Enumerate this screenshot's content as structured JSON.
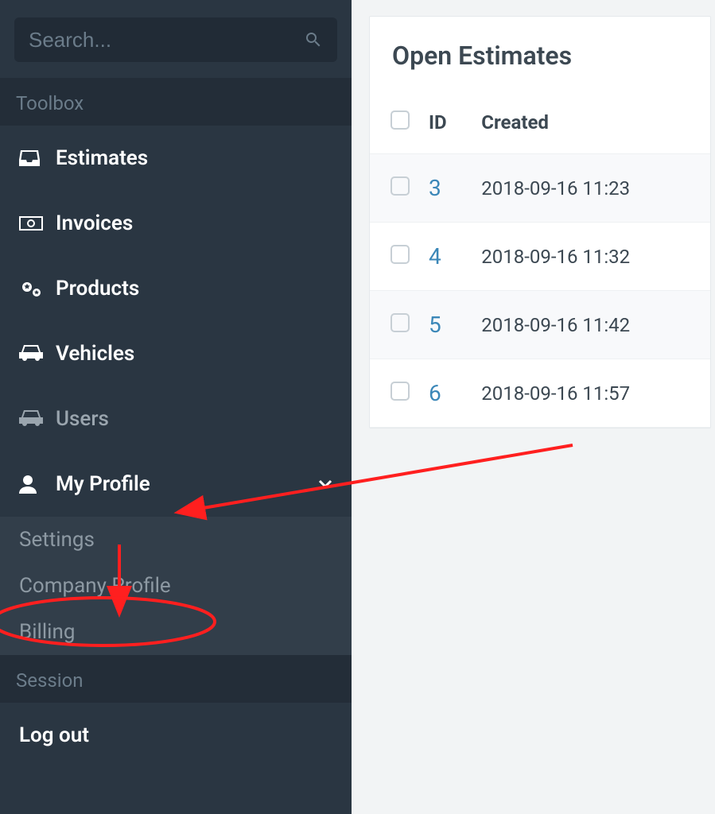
{
  "search": {
    "placeholder": "Search..."
  },
  "sidebar": {
    "sections": {
      "toolbox": {
        "label": "Toolbox"
      },
      "session": {
        "label": "Session"
      }
    },
    "items": {
      "estimates": {
        "label": "Estimates"
      },
      "invoices": {
        "label": "Invoices"
      },
      "products": {
        "label": "Products"
      },
      "vehicles": {
        "label": "Vehicles"
      },
      "users": {
        "label": "Users"
      },
      "my_profile": {
        "label": "My Profile"
      },
      "logout": {
        "label": "Log out"
      }
    },
    "profile_sub": {
      "settings": {
        "label": "Settings"
      },
      "company_profile": {
        "label": "Company Profile"
      },
      "billing": {
        "label": "Billing"
      }
    }
  },
  "main": {
    "card_title": "Open Estimates",
    "table": {
      "headers": {
        "id": "ID",
        "created": "Created"
      },
      "rows": [
        {
          "id": "3",
          "created": "2018-09-16 11:23"
        },
        {
          "id": "4",
          "created": "2018-09-16 11:32"
        },
        {
          "id": "5",
          "created": "2018-09-16 11:42"
        },
        {
          "id": "6",
          "created": "2018-09-16 11:57"
        }
      ]
    }
  }
}
